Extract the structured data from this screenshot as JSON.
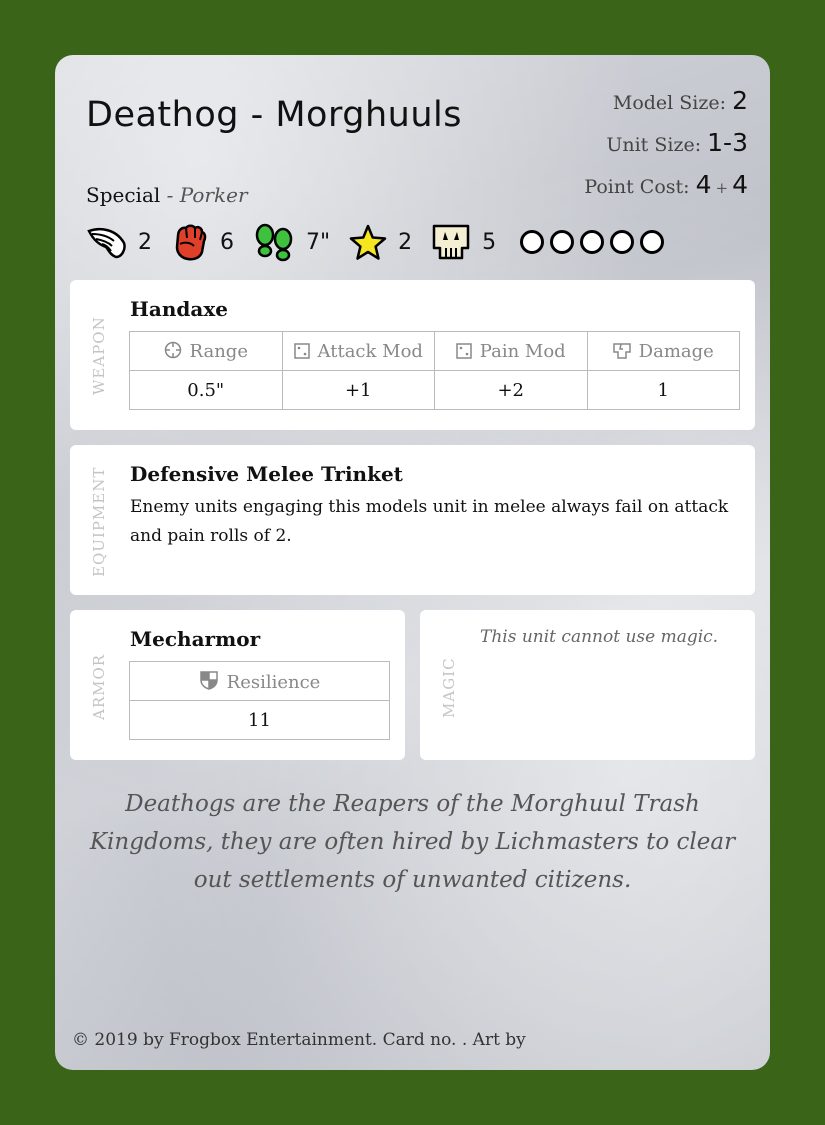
{
  "card": {
    "title": "Deathog - Morghuuls",
    "model_size_label": "Model Size:",
    "model_size_value": "2",
    "unit_size_label": "Unit Size:",
    "unit_size_value": "1-3",
    "point_cost_label": "Point Cost:",
    "point_cost_base": "4",
    "point_cost_plus": "+",
    "point_cost_extra": "4",
    "special_label": "Special",
    "special_sub": "- Porker",
    "stats": {
      "speed": "2",
      "melee": "6",
      "move": "7\"",
      "star": "2",
      "skull": "5",
      "wound_circles": 5
    }
  },
  "weapon": {
    "section_label": "WEAPON",
    "name": "Handaxe",
    "headers": [
      "Range",
      "Attack Mod",
      "Pain Mod",
      "Damage"
    ],
    "values": [
      "0.5\"",
      "+1",
      "+2",
      "1"
    ]
  },
  "equipment": {
    "section_label": "EQUIPMENT",
    "name": "Defensive Melee Trinket",
    "text": "Enemy units engaging this models unit in melee always fail on attack and pain rolls of 2."
  },
  "armor": {
    "section_label": "ARMOR",
    "name": "Mecharmor",
    "header": "Resilience",
    "value": "11"
  },
  "magic": {
    "section_label": "MAGIC",
    "note": "This unit cannot use magic."
  },
  "flavor": "Deathogs are the Reapers of the Morghuul Trash Kingdoms, they are often hired by Lichmasters to clear out settlements of unwanted citizens.",
  "footer": "© 2019 by Frogbox Entertainment. Card no. . Art by",
  "icons": {
    "speed": "wing-icon",
    "melee": "fist-icon",
    "move": "footprints-icon",
    "star": "star-icon",
    "skull": "skull-icon",
    "range": "crosshair-icon",
    "attack_mod": "die-icon",
    "pain_mod": "die-icon",
    "damage": "broken-shield-icon",
    "resilience": "shield-icon"
  },
  "colors": {
    "background": "#3a6518",
    "fist": "#e0402a",
    "footprints": "#3ec23e",
    "star": "#f5e620"
  }
}
